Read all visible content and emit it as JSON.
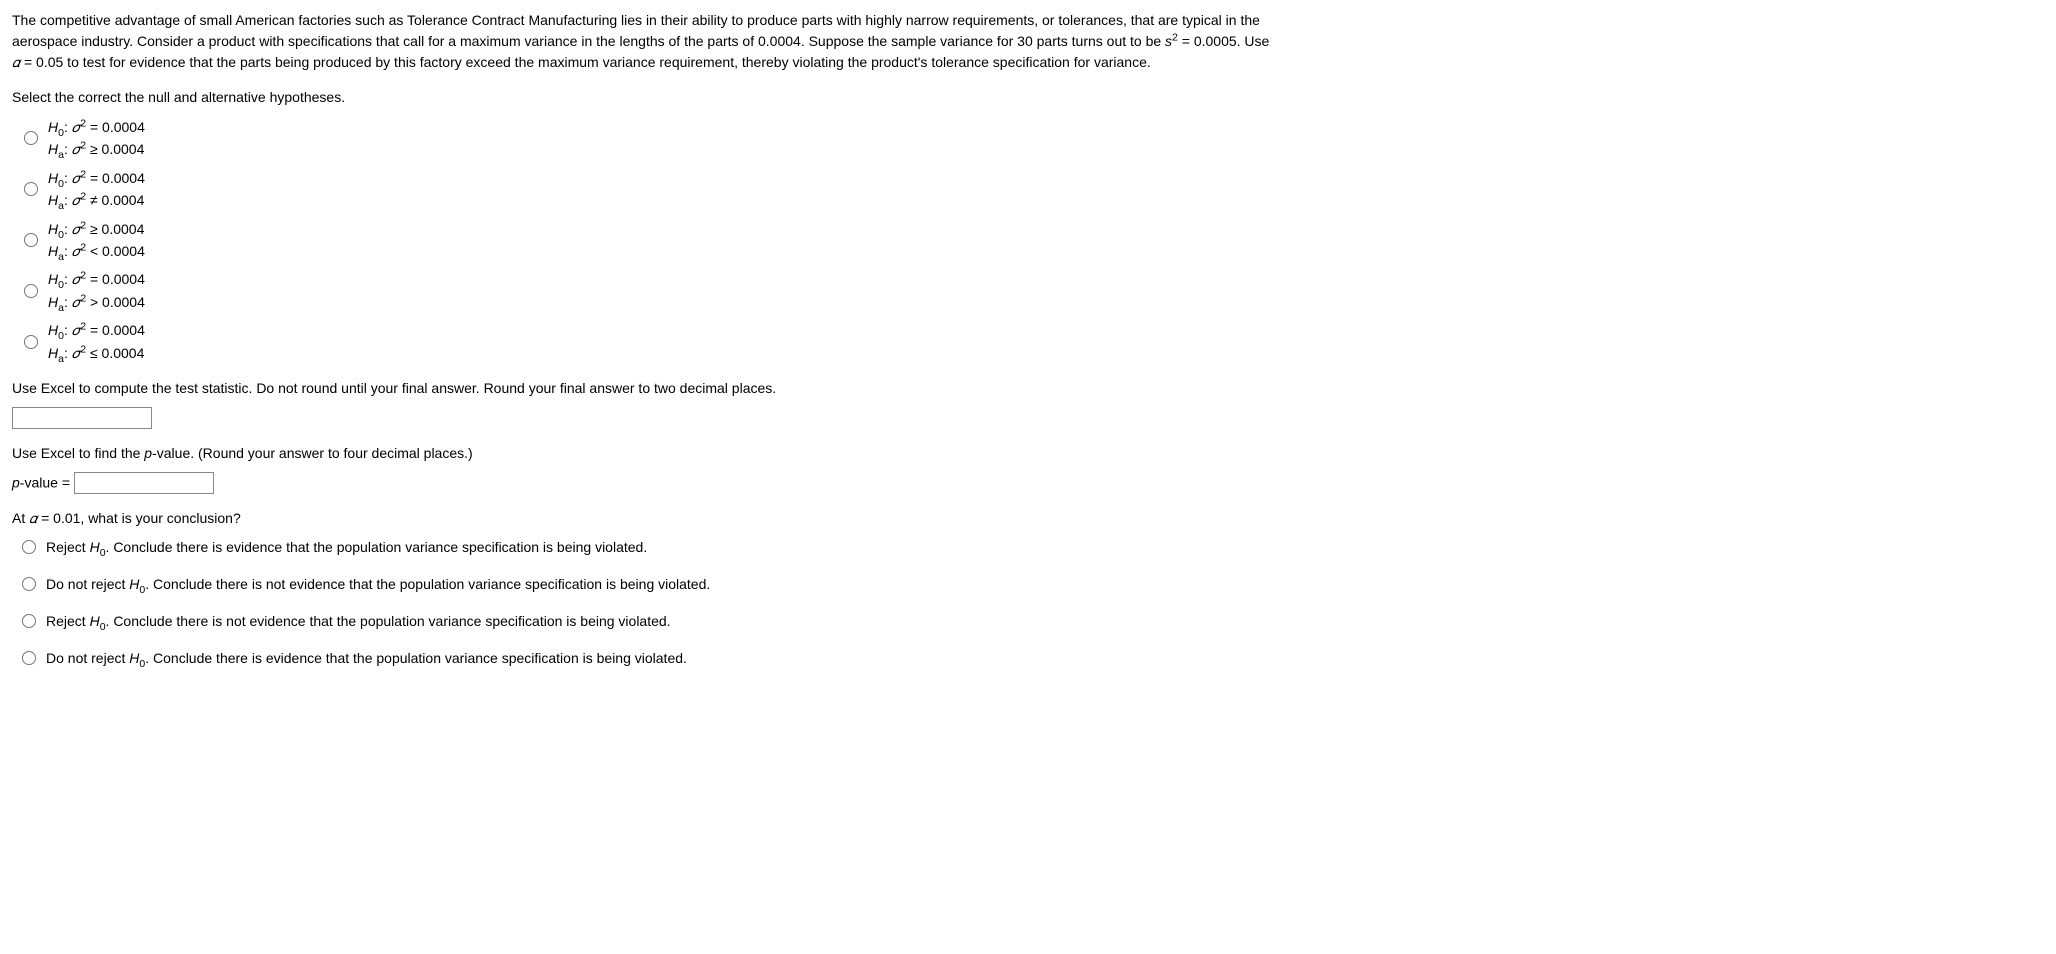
{
  "intro": {
    "line1": "The competitive advantage of small American factories such as Tolerance Contract Manufacturing lies in their ability to produce parts with highly narrow requirements, or tolerances, that are typical in the",
    "line2_a": "aerospace industry. Consider a product with specifications that call for a maximum variance in the lengths of the parts of 0.0004. Suppose the sample variance for 30 parts turns out to be ",
    "line2_b": " = 0.0005. Use",
    "s_label": "s",
    "line3_a": " = 0.05 to test for evidence that the parts being produced by this factory exceed the maximum variance requirement, thereby violating the product's tolerance specification for variance.",
    "alpha": "𝛼"
  },
  "q1_prompt": "Select the correct the null and alternative hypotheses.",
  "hyp": {
    "H0": "H",
    "sub0": "0",
    "Ha": "H",
    "suba": "a",
    "sigma": "𝜎",
    "sq": "2",
    "o1_h0": " = 0.0004",
    "o1_ha": " ≥ 0.0004",
    "o2_h0": " = 0.0004",
    "o2_ha": " ≠ 0.0004",
    "o3_h0": " ≥ 0.0004",
    "o3_ha": " < 0.0004",
    "o4_h0": " = 0.0004",
    "o4_ha": " > 0.0004",
    "o5_h0": " = 0.0004",
    "o5_ha": " ≤ 0.0004"
  },
  "q2_prompt": "Use Excel to compute the test statistic. Do not round until your final answer. Round your final answer to two decimal places.",
  "q3_prompt_a": "Use Excel to find the ",
  "q3_prompt_b": "-value. (Round your answer to four decimal places.)",
  "p_label": "p",
  "pvalue_label_a": "p",
  "pvalue_label_b": "-value = ",
  "q4_prompt_a": "At ",
  "q4_prompt_b": " = 0.01, what is your conclusion?",
  "conc": {
    "reject": "Reject ",
    "dontreject": "Do not reject ",
    "c1": ". Conclude there is evidence that the population variance specification is being violated.",
    "c2": ". Conclude there is not evidence that the population variance specification is being violated.",
    "c3": ". Conclude there is not evidence that the population variance specification is being violated.",
    "c4": ". Conclude there is evidence that the population variance specification is being violated."
  }
}
